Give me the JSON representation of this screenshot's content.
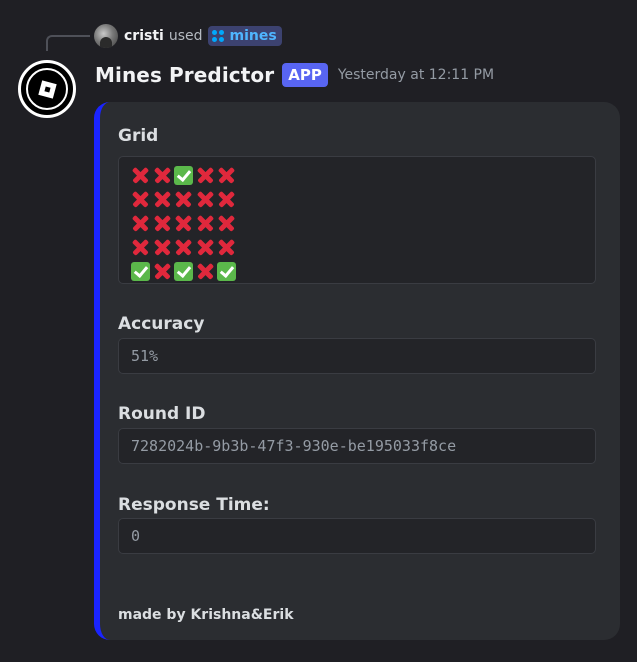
{
  "reply": {
    "username": "cristi",
    "used_text": "used",
    "command_name": "mines",
    "command_icon": "slash-command-app-icon"
  },
  "message": {
    "bot_name": "Mines Predictor",
    "badge": "APP",
    "timestamp": "Yesterday at 12:11 PM",
    "bot_avatar_icon": "roblox-logo-icon"
  },
  "embed": {
    "accent_color": "#1a24ff",
    "fields": {
      "grid": {
        "name": "Grid",
        "rows": [
          [
            "x",
            "x",
            "ok",
            "x",
            "x"
          ],
          [
            "x",
            "x",
            "x",
            "x",
            "x"
          ],
          [
            "x",
            "x",
            "x",
            "x",
            "x"
          ],
          [
            "x",
            "x",
            "x",
            "x",
            "x"
          ],
          [
            "ok",
            "x",
            "ok",
            "x",
            "ok"
          ]
        ],
        "legend_icons": {
          "x": "cross-mark-icon",
          "ok": "check-mark-button-icon"
        }
      },
      "accuracy": {
        "name": "Accuracy",
        "value": "51%"
      },
      "round_id": {
        "name": "Round ID",
        "value": "7282024b-9b3b-47f3-930e-be195033f8ce"
      },
      "response_time": {
        "name": "Response Time:",
        "value": "0"
      }
    },
    "footer": "made by Krishna&Erik"
  },
  "colors": {
    "background": "#1f1f24",
    "embed_background": "#2b2d31",
    "app_badge": "#5865f2",
    "command_chip": "#3c4270",
    "cross": "#e0283c",
    "check": "#5bb84b"
  }
}
